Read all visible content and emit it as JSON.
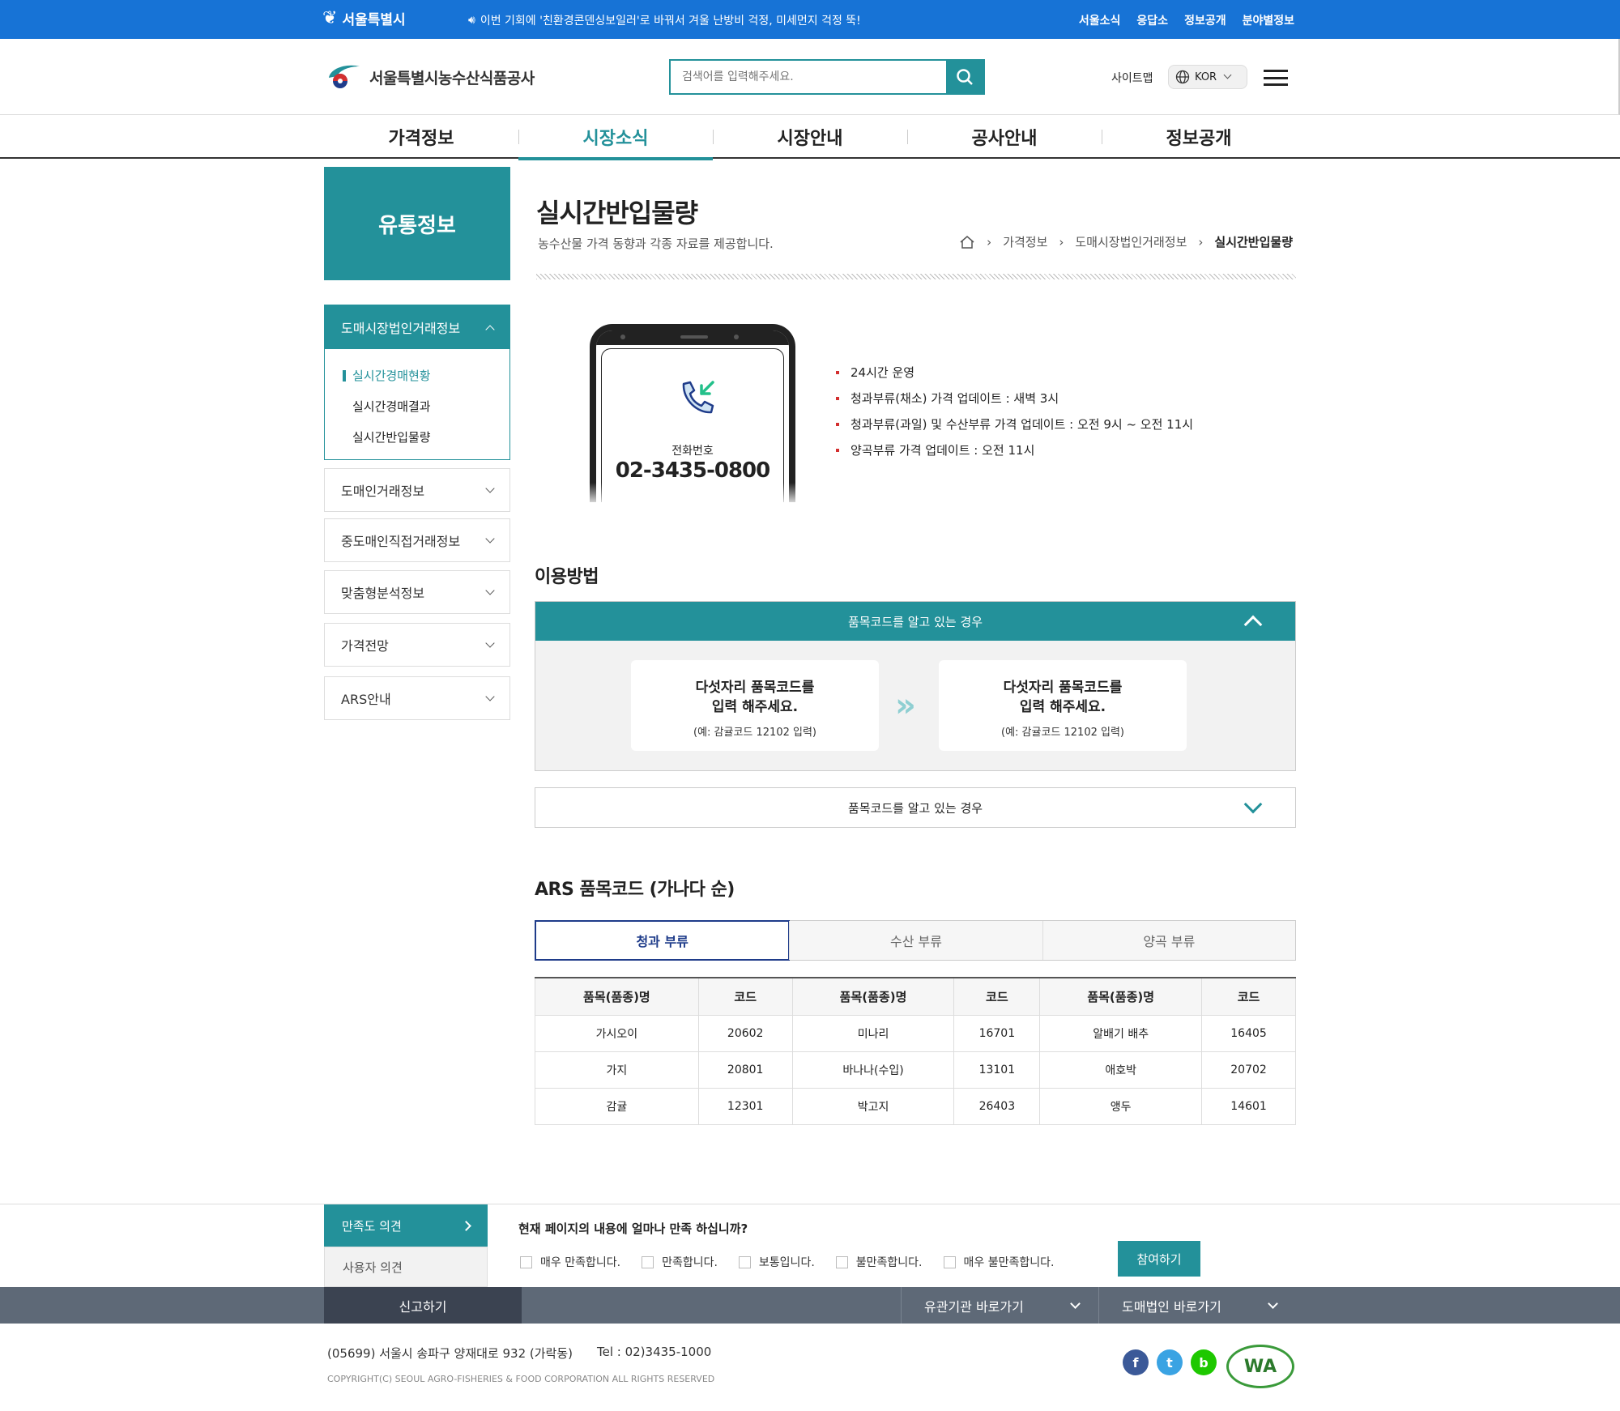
{
  "topbar": {
    "logo": "서울특별시",
    "notice": "이번 기회에 '친환경콘덴싱보일러'로 바꿔서 겨울 난방비 걱정, 미세먼지 걱정 뚝!",
    "links": [
      "서울소식",
      "응답소",
      "정보공개",
      "분야별정보"
    ],
    "color": "#1773d6"
  },
  "header": {
    "brand": "서울특별시농수산식품공사",
    "search_placeholder": "검색어를 입력해주세요.",
    "sitemap": "사이트맵",
    "lang": "KOR"
  },
  "gnb": {
    "items": [
      "가격정보",
      "시장소식",
      "시장안내",
      "공사안내",
      "정보공개"
    ],
    "active_index": 1,
    "accent": "#23919a"
  },
  "lnb": {
    "title": "유통정보",
    "open_group": {
      "label": "도매시장법인거래정보",
      "items": [
        "실시간경매현황",
        "실시간경매결과",
        "실시간반입물량"
      ],
      "active_index": 0
    },
    "groups": [
      "도매인거래정보",
      "중도매인직접거래정보",
      "맞춤형분석정보",
      "가격전망",
      "ARS안내"
    ]
  },
  "content": {
    "title": "실시간반입물량",
    "description": "농수산물 가격 동향과 각종 자료를 제공합니다.",
    "breadcrumb": [
      "가격정보",
      "도매시장법인거래정보",
      "실시간반입물량"
    ]
  },
  "phone": {
    "label": "전화번호",
    "number": "02-3435-0800"
  },
  "features": [
    "24시간 운영",
    "청과부류(채소) 가격 업데이트 : 새벽 3시",
    "청과부류(과일) 및 수산부류 가격 업데이트 : 오전 9시 ~ 오전 11시",
    "양곡부류 가격 업데이트 : 오전 11시"
  ],
  "usage": {
    "title": "이용방법",
    "open_panel": {
      "title": "품목코드를 알고 있는 경우",
      "steps": [
        {
          "line1": "다섯자리 품목코드를",
          "line2": "입력 해주세요.",
          "example": "(예: 감귤코드 12102 입력)"
        },
        {
          "line1": "다섯자리 품목코드를",
          "line2": "입력 해주세요.",
          "example": "(예: 감귤코드 12102 입력)"
        }
      ]
    },
    "closed_panel_title": "품목코드를 알고 있는 경우"
  },
  "codes": {
    "title": "ARS 품목코드 (가나다 순)",
    "tabs": [
      "청과 부류",
      "수산 부류",
      "양곡 부류"
    ],
    "active_tab": 0,
    "headers": [
      "품목(품종)명",
      "코드",
      "품목(품종)명",
      "코드",
      "품목(품종)명",
      "코드"
    ],
    "rows": [
      [
        "가시오이",
        "20602",
        "미나리",
        "16701",
        "알배기 배추",
        "16405"
      ],
      [
        "가지",
        "20801",
        "바나나(수입)",
        "13101",
        "애호박",
        "20702"
      ],
      [
        "감귤",
        "12301",
        "박고지",
        "26403",
        "앵두",
        "14601"
      ]
    ]
  },
  "survey": {
    "tab_active": "만족도 의견",
    "tab_other": "사용자 의견",
    "question": "현재 페이지의 내용에 얼마나 만족 하십니까?",
    "options": [
      "매우 만족합니다.",
      "만족합니다.",
      "보통입니다.",
      "불만족합니다.",
      "매우 불만족합니다."
    ],
    "submit": "참여하기"
  },
  "footer": {
    "report": "신고하기",
    "drop1": "유관기관 바로가기",
    "drop2": "도매법인 바로가기",
    "address": "(05699) 서울시 송파구 양재대로 932 (가락동)",
    "tel": "Tel : 02)3435-1000",
    "copyright": "COPYRIGHT(C) SEOUL AGRO-FISHERIES & FOOD CORPORATION ALL RIGHTS RESERVED",
    "social": [
      {
        "icon": "facebook-icon",
        "glyph": "f",
        "color": "#3b5998"
      },
      {
        "icon": "twitter-icon",
        "glyph": "t",
        "color": "#3aa3e3"
      },
      {
        "icon": "blog-icon",
        "glyph": "b",
        "color": "#1ec800"
      }
    ],
    "wa_mark": "WA"
  }
}
